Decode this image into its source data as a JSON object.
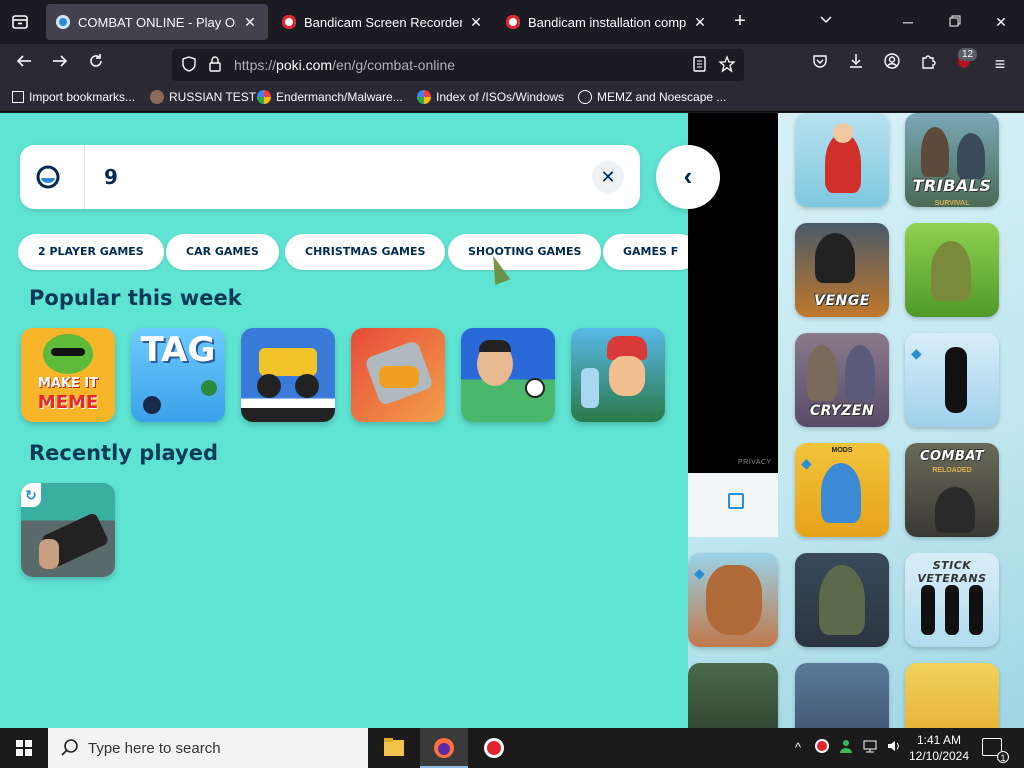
{
  "browser": {
    "tabs": [
      {
        "title": "COMBAT ONLINE - Play Online",
        "active": true,
        "icon": "poki-icon"
      },
      {
        "title": "Bandicam Screen Recorder Dow",
        "active": false,
        "icon": "bandicam-icon"
      },
      {
        "title": "Bandicam installation complete",
        "active": false,
        "icon": "bandicam-icon"
      }
    ],
    "url_prefix": "https://",
    "url_host": "poki.com",
    "url_path": "/en/g/combat-online",
    "extension_badge": "12",
    "bookmarks": [
      {
        "label": "Import bookmarks...",
        "icon": "import-icon"
      },
      {
        "label": "RUSSIAN TEST",
        "icon": "avatar-icon"
      },
      {
        "label": "Endermanch/Malware...",
        "icon": "google-icon"
      },
      {
        "label": "Index of /ISOs/Windows",
        "icon": "google-icon"
      },
      {
        "label": "MEMZ and Noescape ...",
        "icon": "globe-icon"
      }
    ]
  },
  "poki": {
    "search_value": "9",
    "categories": [
      "2 PLAYER GAMES",
      "CAR GAMES",
      "CHRISTMAS GAMES",
      "SHOOTING GAMES",
      "GAMES F"
    ],
    "popular_title": "Popular this week",
    "recent_title": "Recently played",
    "popular_games": [
      {
        "label": "MAKE IT MEME",
        "line1": "MAKE IT",
        "line2": "MEME"
      },
      {
        "label": "TAG"
      },
      {
        "label": ""
      },
      {
        "label": ""
      },
      {
        "label": ""
      },
      {
        "label": ""
      }
    ],
    "right_games": [
      {
        "label": ""
      },
      {
        "label": "TRIBALS",
        "sub": "SURVIVAL"
      },
      {
        "label": "VENGE"
      },
      {
        "label": ""
      },
      {
        "label": "CRYZEN"
      },
      {
        "label": ""
      },
      {
        "label": "",
        "sub": "MODS"
      },
      {
        "label": "COMBAT",
        "sub": "RELOADED"
      },
      {
        "label": ""
      },
      {
        "label": ""
      },
      {
        "label": "STICK VETERANS"
      }
    ],
    "privacy": "PRIVACY"
  },
  "taskbar": {
    "search_placeholder": "Type here to search",
    "time": "1:41 AM",
    "date": "12/10/2024",
    "notification_count": "1"
  },
  "colors": {
    "poki_bg": "#5fe3d3",
    "text_dark": "#0a3a57",
    "tab_active": "#42414d",
    "toolbar": "#2b2a33"
  }
}
